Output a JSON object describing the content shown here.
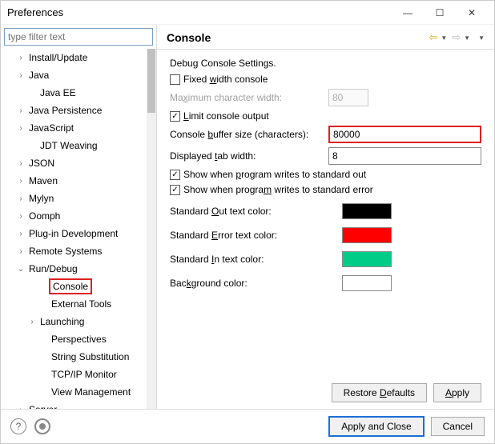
{
  "window": {
    "title": "Preferences"
  },
  "filter": {
    "placeholder": "type filter text"
  },
  "tree": [
    {
      "label": "Install/Update",
      "expand": ">",
      "indent": 18
    },
    {
      "label": "Java",
      "expand": ">",
      "indent": 18
    },
    {
      "label": "Java EE",
      "expand": "",
      "indent": 32
    },
    {
      "label": "Java Persistence",
      "expand": ">",
      "indent": 18
    },
    {
      "label": "JavaScript",
      "expand": ">",
      "indent": 18
    },
    {
      "label": "JDT Weaving",
      "expand": "",
      "indent": 32
    },
    {
      "label": "JSON",
      "expand": ">",
      "indent": 18
    },
    {
      "label": "Maven",
      "expand": ">",
      "indent": 18
    },
    {
      "label": "Mylyn",
      "expand": ">",
      "indent": 18
    },
    {
      "label": "Oomph",
      "expand": ">",
      "indent": 18
    },
    {
      "label": "Plug-in Development",
      "expand": ">",
      "indent": 18
    },
    {
      "label": "Remote Systems",
      "expand": ">",
      "indent": 18
    },
    {
      "label": "Run/Debug",
      "expand": "v",
      "indent": 18
    },
    {
      "label": "Console",
      "expand": "",
      "indent": 46,
      "selected": true
    },
    {
      "label": "External Tools",
      "expand": "",
      "indent": 46
    },
    {
      "label": "Launching",
      "expand": ">",
      "indent": 32
    },
    {
      "label": "Perspectives",
      "expand": "",
      "indent": 46
    },
    {
      "label": "String Substitution",
      "expand": "",
      "indent": 46
    },
    {
      "label": "TCP/IP Monitor",
      "expand": "",
      "indent": 46
    },
    {
      "label": "View Management",
      "expand": "",
      "indent": 46
    },
    {
      "label": "Server",
      "expand": ">",
      "indent": 18
    }
  ],
  "header": {
    "title": "Console"
  },
  "settings": {
    "desc": "Debug Console Settings.",
    "fixed_width": {
      "label_pre": "Fixed ",
      "label_u": "w",
      "label_post": "idth console",
      "checked": false
    },
    "max_char_width": {
      "label_pre": "Ma",
      "label_u": "x",
      "label_post": "imum character width:",
      "value": "80"
    },
    "limit": {
      "label_u": "L",
      "label_post": "imit console output",
      "checked": true
    },
    "buffer": {
      "label_pre": "Console ",
      "label_u": "b",
      "label_post": "uffer size (characters):",
      "value": "80000"
    },
    "tab_width": {
      "label_pre": "Displayed ",
      "label_u": "t",
      "label_post": "ab width:",
      "value": "8"
    },
    "show_out": {
      "label_pre": "Show when ",
      "label_u": "p",
      "label_post": "rogram writes to standard out",
      "checked": true
    },
    "show_err": {
      "label_pre": "Show when progra",
      "label_u": "m",
      "label_post": " writes to standard error",
      "checked": true
    },
    "colors": [
      {
        "label_pre": "Standard ",
        "label_u": "O",
        "label_post": "ut text color:",
        "color": "#000000"
      },
      {
        "label_pre": "Standard ",
        "label_u": "E",
        "label_post": "rror text color:",
        "color": "#ff0000"
      },
      {
        "label_pre": "Standard ",
        "label_u": "I",
        "label_post": "n text color:",
        "color": "#00cc88"
      },
      {
        "label_pre": "Bac",
        "label_u": "k",
        "label_post": "ground color:",
        "color": "#ffffff"
      }
    ]
  },
  "buttons": {
    "restore": {
      "pre": "Restore ",
      "u": "D",
      "post": "efaults"
    },
    "apply": {
      "u": "A",
      "post": "pply"
    },
    "apply_close": "Apply and Close",
    "cancel": "Cancel"
  }
}
